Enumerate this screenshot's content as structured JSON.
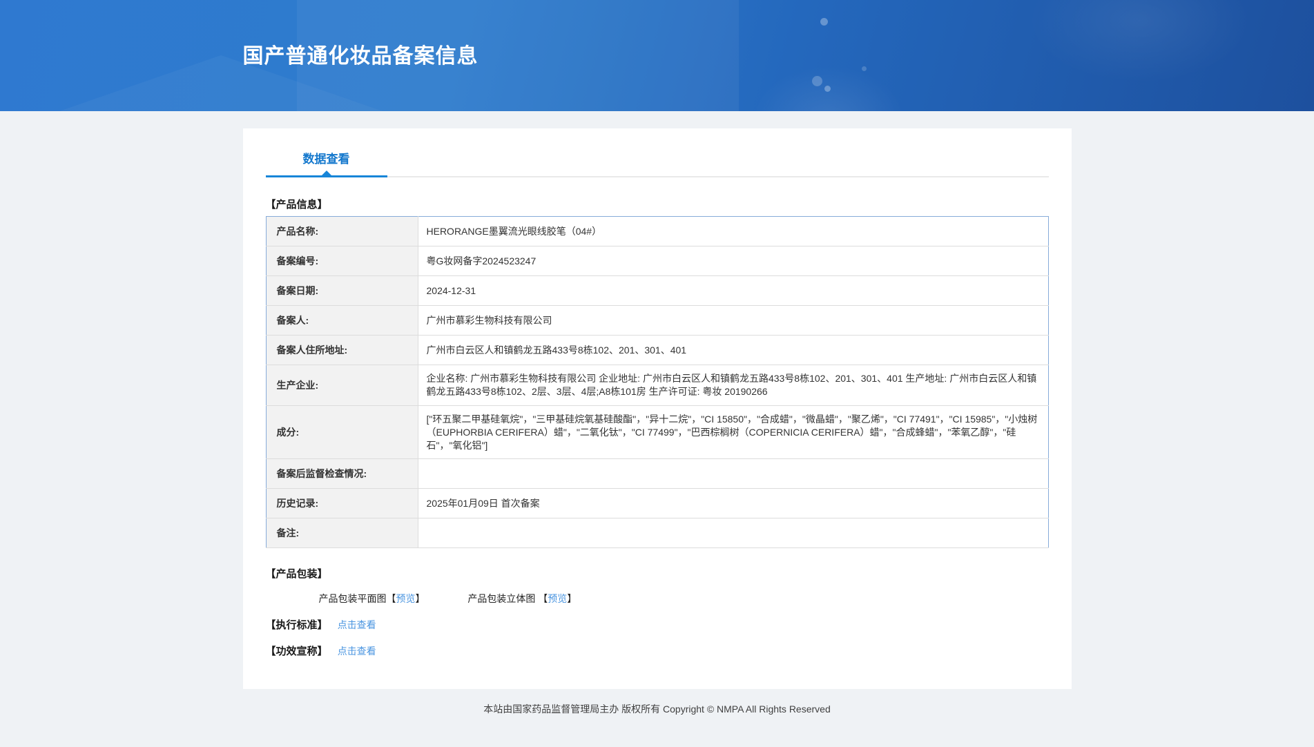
{
  "header": {
    "title": "国产普通化妆品备案信息"
  },
  "tab": {
    "label": "数据查看"
  },
  "product_info": {
    "title": "【产品信息】",
    "rows": [
      {
        "label": "产品名称:",
        "value": "HERORANGE墨翼流光眼线胶笔（04#）"
      },
      {
        "label": "备案编号:",
        "value": "粤G妆网备字2024523247"
      },
      {
        "label": "备案日期:",
        "value": "2024-12-31"
      },
      {
        "label": "备案人:",
        "value": "广州市慕彩生物科技有限公司"
      },
      {
        "label": "备案人住所地址:",
        "value": "广州市白云区人和镇鹤龙五路433号8栋102、201、301、401"
      },
      {
        "label": "生产企业:",
        "value": "企业名称: 广州市慕彩生物科技有限公司 企业地址: 广州市白云区人和镇鹤龙五路433号8栋102、201、301、401 生产地址: 广州市白云区人和镇鹤龙五路433号8栋102、2层、3层、4层;A8栋101房 生产许可证: 粤妆 20190266"
      },
      {
        "label": "成分:",
        "value": "[\"环五聚二甲基硅氧烷\"，\"三甲基硅烷氧基硅酸酯\"，\"异十二烷\"，\"CI 15850\"，\"合成蜡\"，\"微晶蜡\"，\"聚乙烯\"，\"CI 77491\"，\"CI 15985\"，\"小烛树（EUPHORBIA CERIFERA）蜡\"，\"二氧化钛\"，\"CI 77499\"，\"巴西棕榈树（COPERNICIA CERIFERA）蜡\"，\"合成蜂蜡\"，\"苯氧乙醇\"，\"硅石\"，\"氧化铝\"]"
      },
      {
        "label": "备案后监督检查情况:",
        "value": ""
      },
      {
        "label": "历史记录:",
        "value": "2025年01月09日 首次备案"
      },
      {
        "label": "备注:",
        "value": ""
      }
    ]
  },
  "packaging": {
    "title": "【产品包装】",
    "items": [
      {
        "label": "产品包装平面图",
        "bracket_open": "【",
        "link": "预览",
        "bracket_close": "】"
      },
      {
        "label": "产品包装立体图 ",
        "bracket_open": "【",
        "link": "预览",
        "bracket_close": "】"
      }
    ]
  },
  "standards": {
    "title": "【执行标准】",
    "link": "点击查看"
  },
  "efficacy": {
    "title": "【功效宣称】",
    "link": "点击查看"
  },
  "footer": {
    "text": "本站由国家药品监督管理局主办 版权所有 Copyright © NMPA All Rights Reserved"
  },
  "colors": {
    "accent_blue": "#1785d8",
    "link_blue": "#4a95e0",
    "header_gradient_start": "#2f79d0",
    "header_gradient_end": "#1d509e",
    "table_outer_border": "#86abd9",
    "label_cell_bg": "#f2f2f2",
    "page_bg": "#eff2f5"
  }
}
